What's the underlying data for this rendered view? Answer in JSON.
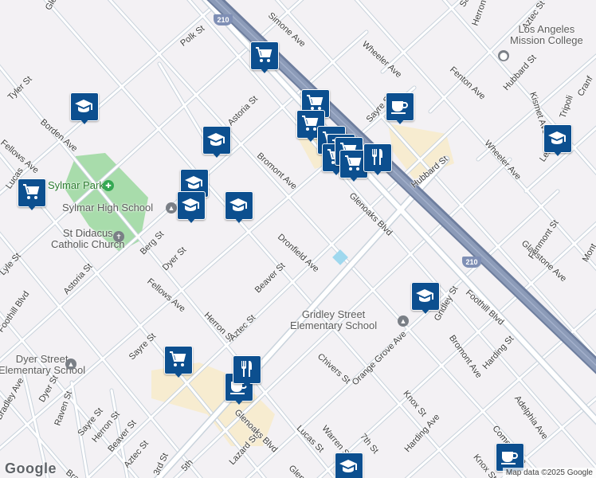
{
  "map": {
    "colors": {
      "background": "#f3f1f4",
      "road": "#ffffff",
      "road_casing": "#c9d3dc",
      "freeway": "#8c9bb8",
      "freeway_edge": "#6e7e9e",
      "park": "#a8dcab",
      "commercial": "#f7ecd0",
      "pin": "#0c4f8f"
    }
  },
  "streets": [
    {
      "text": "Polk St"
    },
    {
      "text": "Tyler St"
    },
    {
      "text": "Borden Ave"
    },
    {
      "text": "Fellows Ave"
    },
    {
      "text": "Astoria St"
    },
    {
      "text": "Bromont Ave"
    },
    {
      "text": "Simone Ave"
    },
    {
      "text": "Wheeler Ave"
    },
    {
      "text": "Sayre St"
    },
    {
      "text": "Hubbard St"
    },
    {
      "text": "Fenton Ave"
    },
    {
      "text": "Kismet Ave"
    },
    {
      "text": "Wheeler Ave"
    },
    {
      "text": "Dronfield Ave"
    },
    {
      "text": "Berg St"
    },
    {
      "text": "Dyer St"
    },
    {
      "text": "Fellows Ave"
    },
    {
      "text": "Beaver St"
    },
    {
      "text": "Herron St"
    },
    {
      "text": "Aztec St"
    },
    {
      "text": "Sayre St"
    },
    {
      "text": "Astoria St"
    },
    {
      "text": "Lyle St"
    },
    {
      "text": "Gladstone Ave"
    },
    {
      "text": "Foothill Blvd"
    },
    {
      "text": "Gridley St"
    },
    {
      "text": "Bromont Ave"
    },
    {
      "text": "Harding St"
    },
    {
      "text": "Adelphia Ave"
    },
    {
      "text": "Chivers St"
    },
    {
      "text": "Orange Grove Ave"
    },
    {
      "text": "Knox St"
    },
    {
      "text": "Cometa Ave"
    },
    {
      "text": "Harding Ave"
    },
    {
      "text": "Warren St"
    },
    {
      "text": "Lucas St"
    },
    {
      "text": "7th St"
    },
    {
      "text": "Lazard St"
    },
    {
      "text": "Glen"
    },
    {
      "text": "Glenoaks Blvd"
    },
    {
      "text": "5th"
    },
    {
      "text": "Bradl"
    },
    {
      "text": "Bradley Ave"
    },
    {
      "text": "Raven St"
    },
    {
      "text": "Sayre St"
    },
    {
      "text": "Herron St"
    },
    {
      "text": "Beaver St"
    },
    {
      "text": "Aztec St"
    },
    {
      "text": "3rd St"
    },
    {
      "text": "Dyer St"
    },
    {
      "text": "Knox St"
    },
    {
      "text": "Fenmont St"
    },
    {
      "text": "Leach"
    },
    {
      "text": "Tripoli"
    },
    {
      "text": "Cranf"
    },
    {
      "text": "Mont"
    },
    {
      "text": "Herron St"
    },
    {
      "text": "Aztec St"
    },
    {
      "text": "Sayre"
    },
    {
      "text": "Glenoaks Blvd"
    },
    {
      "text": "Hubbard St"
    },
    {
      "text": "Foothill Blvd"
    },
    {
      "text": "Glenoaks B"
    },
    {
      "text": "Lucas"
    }
  ],
  "pois": {
    "lamc": "Los Angeles\nMission College",
    "sylmar_park": "Sylmar Park",
    "sylmar_high": "Sylmar High School",
    "st_didacus": "St Didacus\nCatholic Church",
    "gridley": "Gridley Street\nElementary School",
    "dyer": "Dyer Street\nElementary School"
  },
  "shields": [
    {
      "label": "210"
    },
    {
      "label": "210"
    }
  ],
  "pins": [
    {
      "type": "school",
      "icon": "school-icon"
    },
    {
      "type": "school",
      "icon": "school-icon"
    },
    {
      "type": "school",
      "icon": "school-icon"
    },
    {
      "type": "school",
      "icon": "school-icon"
    },
    {
      "type": "school",
      "icon": "school-icon"
    },
    {
      "type": "school",
      "icon": "school-icon"
    },
    {
      "type": "school",
      "icon": "school-icon"
    },
    {
      "type": "school",
      "icon": "school-icon"
    },
    {
      "type": "grocery",
      "icon": "shopping-cart-icon"
    },
    {
      "type": "grocery",
      "icon": "shopping-cart-icon"
    },
    {
      "type": "grocery",
      "icon": "shopping-cart-icon"
    },
    {
      "type": "grocery",
      "icon": "shopping-cart-icon"
    },
    {
      "type": "grocery",
      "icon": "shopping-cart-icon"
    },
    {
      "type": "grocery",
      "icon": "shopping-cart-icon"
    },
    {
      "type": "grocery",
      "icon": "shopping-cart-icon"
    },
    {
      "type": "grocery",
      "icon": "shopping-cart-icon"
    },
    {
      "type": "grocery",
      "icon": "shopping-cart-icon"
    },
    {
      "type": "grocery",
      "icon": "shopping-cart-icon"
    },
    {
      "type": "cafe",
      "icon": "coffee-cup-icon"
    },
    {
      "type": "cafe",
      "icon": "coffee-cup-icon"
    },
    {
      "type": "cafe",
      "icon": "coffee-cup-icon"
    },
    {
      "type": "restaurant",
      "icon": "fork-knife-icon"
    },
    {
      "type": "restaurant",
      "icon": "fork-knife-icon"
    }
  ],
  "logo": "Google",
  "attribution": "Map data ©2025 Google"
}
